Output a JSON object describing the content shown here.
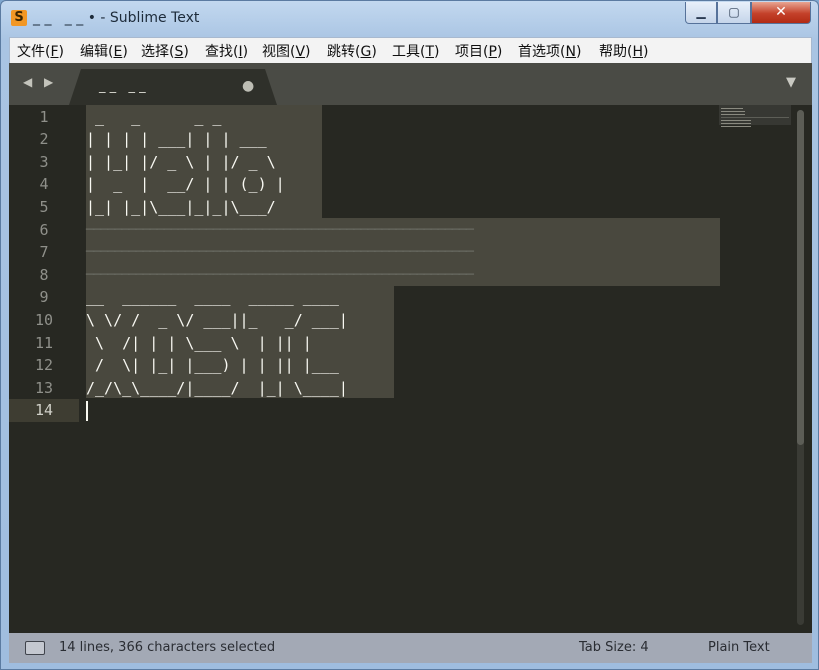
{
  "window": {
    "app_icon_glyph": "S",
    "title": "_ _   _ _ • - Sublime Text",
    "minimize_glyph": "▁",
    "maximize_glyph": "▢",
    "close_glyph": "✕"
  },
  "menu": [
    {
      "text": "文件(",
      "key": "F",
      "end": ")"
    },
    {
      "text": "编辑(",
      "key": "E",
      "end": ")"
    },
    {
      "text": "选择(",
      "key": "S",
      "end": ")"
    },
    {
      "text": "查找(",
      "key": "I",
      "end": ")"
    },
    {
      "text": "视图(",
      "key": "V",
      "end": ")"
    },
    {
      "text": "跳转(",
      "key": "G",
      "end": ")"
    },
    {
      "text": "工具(",
      "key": "T",
      "end": ")"
    },
    {
      "text": "项目(",
      "key": "P",
      "end": ")"
    },
    {
      "text": "首选项(",
      "key": "N",
      "end": ")"
    },
    {
      "text": "帮助(",
      "key": "H",
      "end": ")"
    }
  ],
  "tabs": {
    "nav_arrows": "◀ ▶",
    "active_title": "_ _   _ _",
    "dirty_marker": "●",
    "dropdown_glyph": "▼"
  },
  "editor": {
    "line_numbers": [
      "1",
      "2",
      "3",
      "4",
      "5",
      "6",
      "7",
      "8",
      "9",
      "10",
      "11",
      "12",
      "13",
      "14"
    ],
    "current_line": "14",
    "lines": [
      " _   _      _ _          ",
      "| | | | ___| | | ___     ",
      "| |_| |/ _ \\ | |/ _ \\    ",
      "|  _  |  __/ | | (_) |   ",
      "|_| |_|\\___|_|_|\\___/    ",
      "───────────────────────────────────────────────────────",
      "───────────────────────────────────────────────────────",
      "───────────────────────────────────────────────────────",
      "__  ______  ____  _____ ____ ",
      "\\ \\/ /  _ \\/ ___||_   _/ ___|",
      " \\  /| | | \\___ \\  | || |    ",
      " /  \\| |_| |___) | | || |___ ",
      "/_/\\_\\____/|____/  |_| \\____|",
      ""
    ]
  },
  "status": {
    "selection": "14 lines, 366 characters selected",
    "tab_size": "Tab Size: 4",
    "syntax": "Plain Text"
  }
}
